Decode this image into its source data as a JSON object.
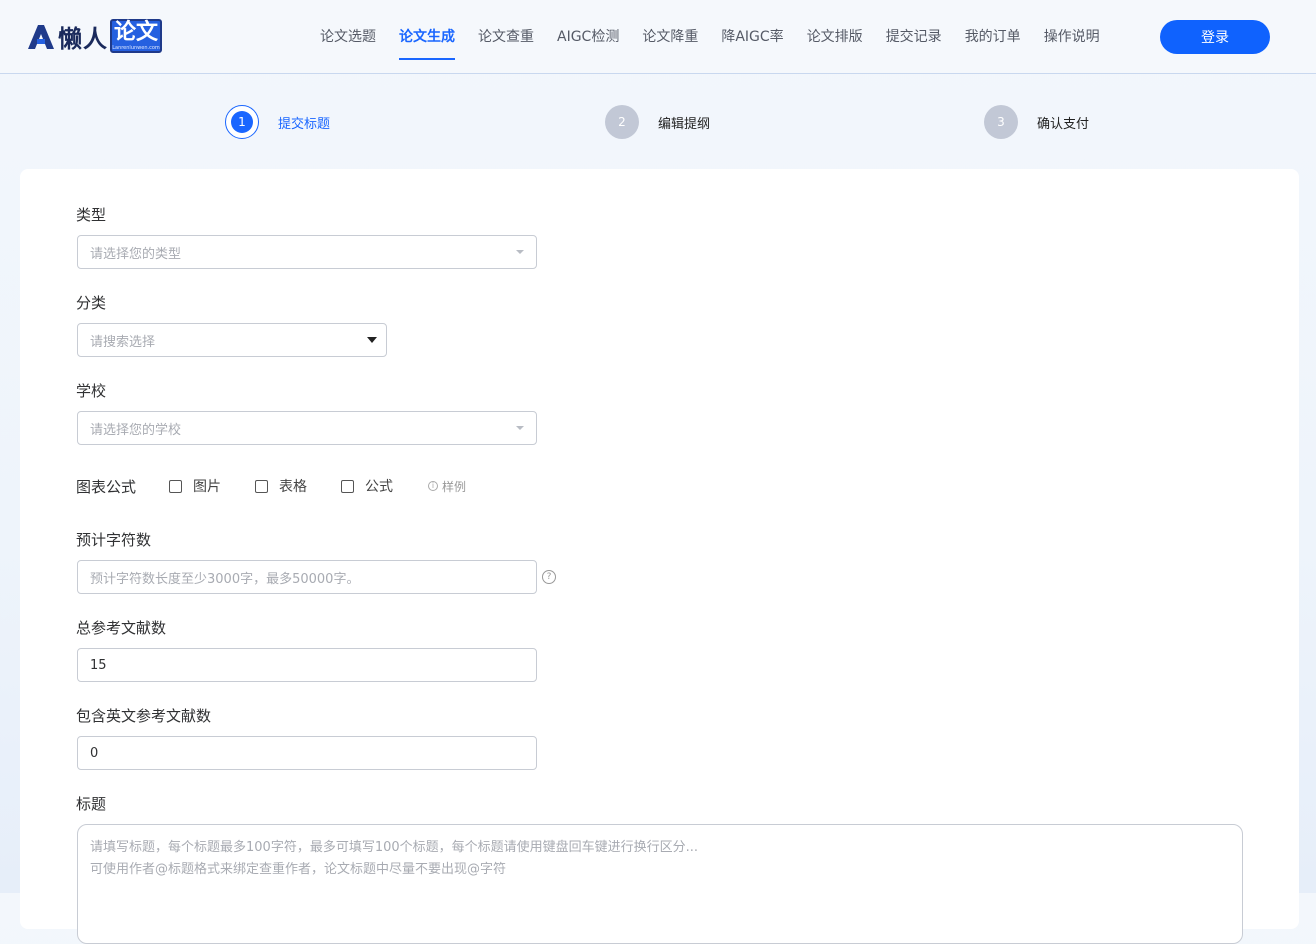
{
  "brand": {
    "name": "懒人",
    "box_text": "论文",
    "box_subtext": "Lanrenlunwen.com"
  },
  "nav": {
    "items": [
      {
        "label": "论文选题",
        "active": false
      },
      {
        "label": "论文生成",
        "active": true
      },
      {
        "label": "论文查重",
        "active": false
      },
      {
        "label": "AIGC检测",
        "active": false
      },
      {
        "label": "论文降重",
        "active": false
      },
      {
        "label": "降AIGC率",
        "active": false
      },
      {
        "label": "论文排版",
        "active": false
      },
      {
        "label": "提交记录",
        "active": false
      },
      {
        "label": "我的订单",
        "active": false
      },
      {
        "label": "操作说明",
        "active": false
      }
    ],
    "login_label": "登录"
  },
  "steps": [
    {
      "number": "1",
      "label": "提交标题",
      "active": true
    },
    {
      "number": "2",
      "label": "编辑提纲",
      "active": false
    },
    {
      "number": "3",
      "label": "确认支付",
      "active": false
    }
  ],
  "form": {
    "type": {
      "label": "类型",
      "placeholder": "请选择您的类型"
    },
    "category": {
      "label": "分类",
      "placeholder": "请搜索选择"
    },
    "school": {
      "label": "学校",
      "placeholder": "请选择您的学校"
    },
    "charts": {
      "label": "图表公式",
      "options": [
        {
          "label": "图片",
          "checked": false
        },
        {
          "label": "表格",
          "checked": false
        },
        {
          "label": "公式",
          "checked": false
        }
      ],
      "sample_label": "样例"
    },
    "char_count": {
      "label": "预计字符数",
      "placeholder": "预计字符数长度至少3000字，最多50000字。"
    },
    "total_refs": {
      "label": "总参考文献数",
      "value": "15"
    },
    "english_refs": {
      "label": "包含英文参考文献数",
      "value": "0"
    },
    "title": {
      "label": "标题",
      "placeholder_line1": "请填写标题，每个标题最多100字符，最多可填写100个标题，每个标题请使用键盘回车键进行换行区分...",
      "placeholder_line2": "可使用作者@标题格式来绑定查重作者，论文标题中尽量不要出现@字符"
    }
  },
  "colors": {
    "accent": "#1a66ff",
    "login_button": "#0f62fe",
    "step_inactive": "#c2c8d6"
  }
}
